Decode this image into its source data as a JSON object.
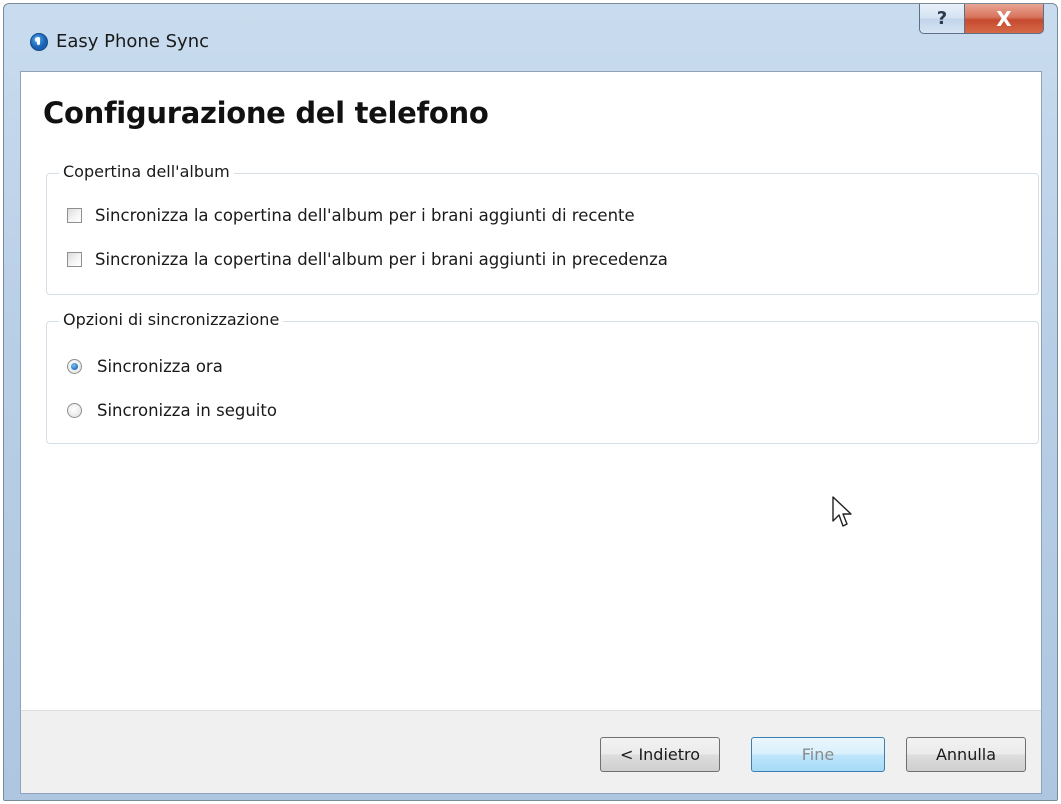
{
  "window": {
    "title": "Easy Phone Sync",
    "help_glyph": "?",
    "close_glyph": "X"
  },
  "page": {
    "title": "Configurazione del telefono"
  },
  "album_art_group": {
    "legend": "Copertina dell'album",
    "options": [
      {
        "label": "Sincronizza la copertina dell'album per i brani aggiunti di recente",
        "checked": false
      },
      {
        "label": "Sincronizza la copertina dell'album per i brani aggiunti in precedenza",
        "checked": false
      }
    ]
  },
  "sync_options_group": {
    "legend": "Opzioni di sincronizzazione",
    "options": [
      {
        "label": "Sincronizza ora",
        "selected": true
      },
      {
        "label": "Sincronizza in seguito",
        "selected": false
      }
    ]
  },
  "footer": {
    "back_label": "< Indietro",
    "finish_label": "Fine",
    "cancel_label": "Annulla"
  }
}
